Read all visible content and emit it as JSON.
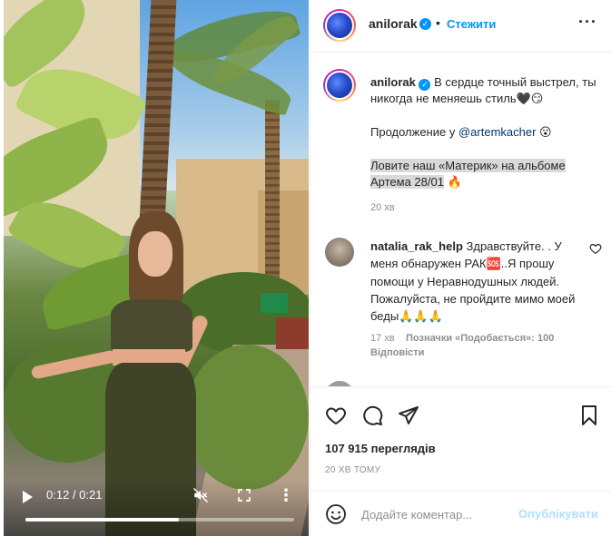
{
  "header": {
    "username": "anilorak",
    "separator": "•",
    "follow_label": "Стежити",
    "more_label": "···"
  },
  "caption": {
    "username": "anilorak",
    "line1": "В сердце точный выстрел, ты никогда не меняешь стиль",
    "emoji1": "🖤😏",
    "line2_prefix": "Продолжение у ",
    "mention": "@artemkacher",
    "emoji2": "😮",
    "line3": "Ловите наш «Материк» на альбоме Артема 28/01",
    "emoji3": "🔥",
    "time": "20 хв"
  },
  "comment": {
    "username": "natalia_rak_help",
    "text_before": "Здравствуйте. . У меня обнаружен РАК",
    "sos": "🆘",
    "text_after": "..Я прошу помощи у Неравнодушных людей. Пожалуйста, не пройдите мимо моей беды",
    "emoji": "🙏🙏🙏",
    "time": "17 хв",
    "likes": "Позначки «Подобається»: 100",
    "reply": "Відповісти"
  },
  "actions": {
    "like_icon": "heart-icon",
    "comment_icon": "comment-icon",
    "share_icon": "share-icon",
    "save_icon": "bookmark-icon",
    "views": "107 915 переглядів",
    "ago": "20 ХВ ТОМУ"
  },
  "composer": {
    "placeholder": "Додайте коментар...",
    "publish_label": "Опублікувати"
  },
  "video": {
    "time": "0:12 / 0:21",
    "progress": 0.57
  },
  "colors": {
    "accent": "#0095f6",
    "publish_disabled": "#b2dffc",
    "muted": "#8e8e8e"
  }
}
